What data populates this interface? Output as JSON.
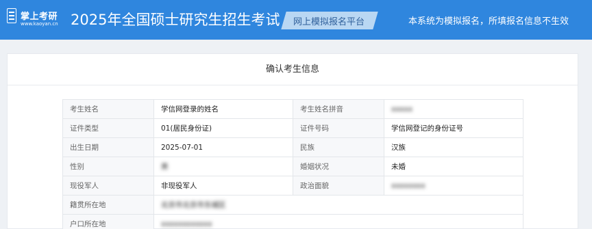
{
  "header": {
    "logo_name": "掌上考研",
    "logo_url": "www.kaoyan.cn",
    "title": "2025年全国硕士研究生招生考试",
    "platform_label": "网上模拟报名平台",
    "notice": "本系统为模拟报名，所填报名信息不生效"
  },
  "card": {
    "title": "确认考生信息"
  },
  "fields": {
    "name_label": "考生姓名",
    "name_value": "学信网登录的姓名",
    "pinyin_label": "考生姓名拼音",
    "pinyin_value": "xxxxx",
    "id_type_label": "证件类型",
    "id_type_value": "01(居民身份证)",
    "id_number_label": "证件号码",
    "id_number_value": "学信网登记的身份证号",
    "birth_label": "出生日期",
    "birth_value": "2025-07-01",
    "ethnicity_label": "民族",
    "ethnicity_value": "汉族",
    "gender_label": "性别",
    "gender_value": "男",
    "marital_label": "婚姻状况",
    "marital_value": "未婚",
    "military_label": "现役军人",
    "military_value": "非现役军人",
    "political_label": "政治面貌",
    "political_value": "xxxxxxxx",
    "native_label": "籍贯所在地",
    "native_value": "北京市北京市东城区",
    "hukou_label": "户口所在地",
    "hukou_value": "xxxxxxxxxxxx"
  }
}
